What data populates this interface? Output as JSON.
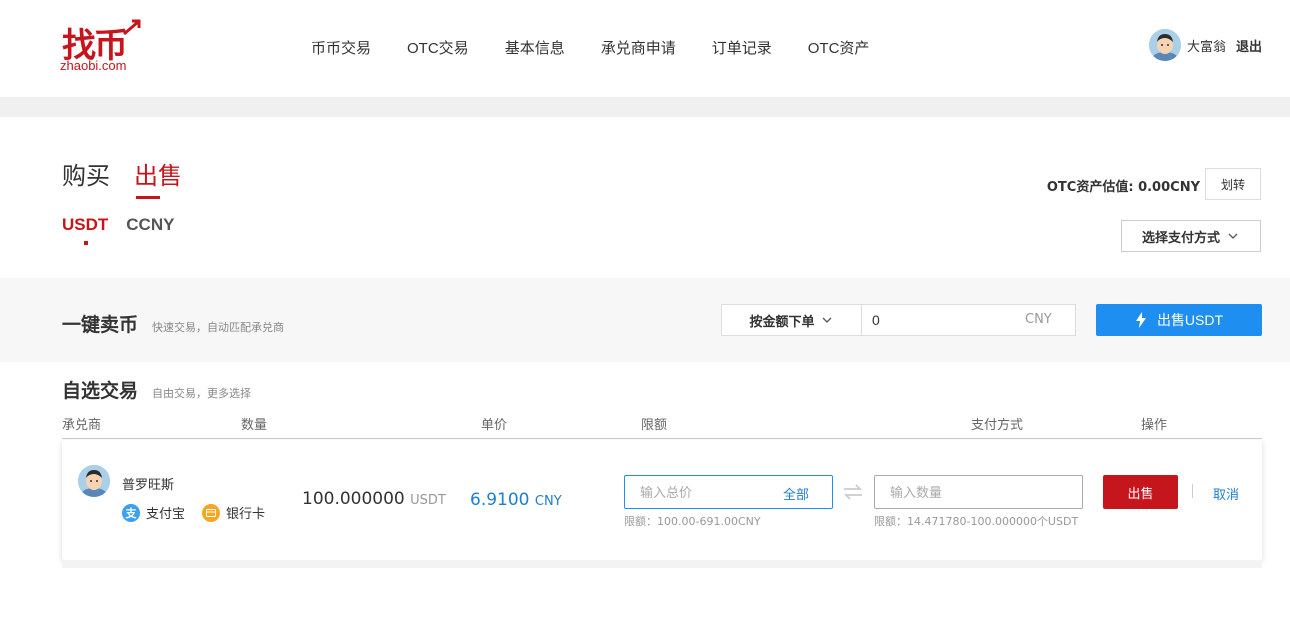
{
  "brand": {
    "logo_text": "找币",
    "domain": "zhaobi.com",
    "color": "#c4161c"
  },
  "nav": {
    "items": [
      "币币交易",
      "OTC交易",
      "基本信息",
      "承兑商申请",
      "订单记录",
      "OTC资产"
    ]
  },
  "user": {
    "name": "大富翁",
    "logout": "退出"
  },
  "tabs": {
    "buy": "购买",
    "sell": "出售"
  },
  "coins": {
    "usdt": "USDT",
    "ccny": "CCNY"
  },
  "asset": {
    "label": "OTC资产估值:",
    "value": "0.00CNY",
    "transfer": "划转"
  },
  "pay_select": {
    "label": "选择支付方式"
  },
  "quick_sell": {
    "title": "一键卖币",
    "subtitle": "快速交易，自动匹配承兑商",
    "mode": "按金额下单",
    "amount_value": "0",
    "unit": "CNY",
    "button": "出售USDT"
  },
  "self_select": {
    "title": "自选交易",
    "subtitle": "自由交易，更多选择"
  },
  "table": {
    "headers": {
      "merchant": "承兑商",
      "quantity": "数量",
      "price": "单价",
      "limit": "限额",
      "payment": "支付方式",
      "action": "操作"
    },
    "row": {
      "merchant": "普罗旺斯",
      "pay1": "支付宝",
      "pay2": "银行卡",
      "quantity": "100.000000",
      "quantity_unit": "USDT",
      "price": "6.9100",
      "price_unit": "CNY",
      "total_placeholder": "输入总价",
      "all": "全部",
      "limit1": "限额：100.00-691.00CNY",
      "num_placeholder": "输入数量",
      "limit2": "限额：14.471780-100.000000个USDT",
      "sell": "出售",
      "cancel": "取消"
    }
  },
  "colors": {
    "accent_red": "#c4161c",
    "accent_blue": "#1e8ef0"
  }
}
